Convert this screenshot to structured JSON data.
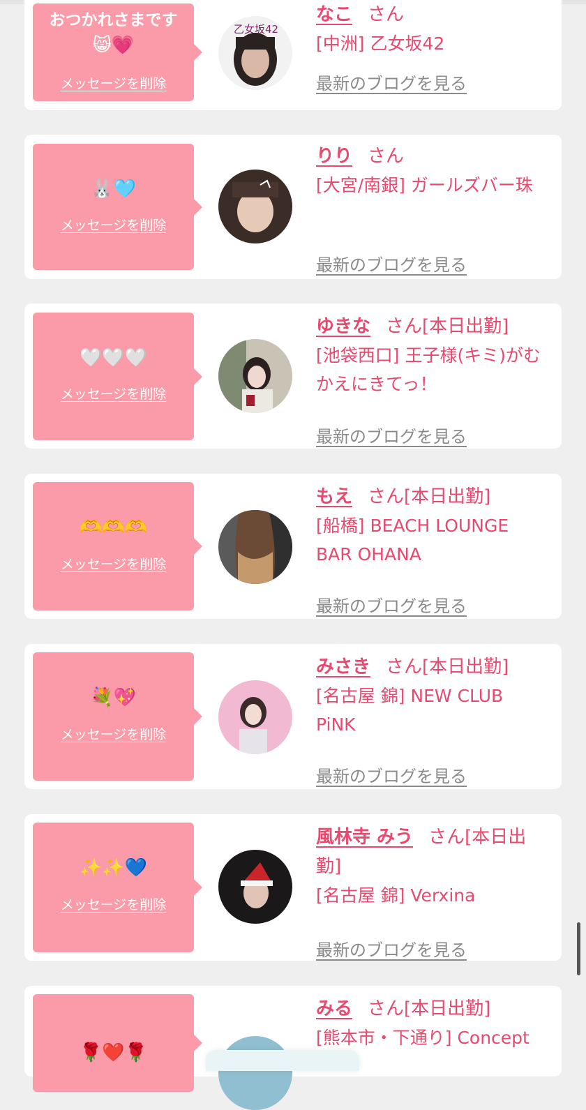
{
  "ui": {
    "delete_label": "メッセージを削除",
    "blog_label": "最新のブログを見る",
    "san_label": "さん"
  },
  "colors": {
    "accent": "#e8496e",
    "bubble": "#fb9aa8",
    "background": "#efefef",
    "card": "#ffffff"
  },
  "messages": [
    {
      "message": "おつかれさまです",
      "emoji": "😸💗",
      "name": "なこ",
      "status": "",
      "shop": "[中洲] 乙女坂42",
      "avatar_text": "乙女坂42"
    },
    {
      "message": "",
      "emoji": "🐰🩵",
      "name": "りり",
      "status": "",
      "shop": "[大宮/南銀] ガールズバー珠"
    },
    {
      "message": "",
      "emoji": "🤍🤍🤍",
      "name": "ゆきな",
      "status": "[本日出勤]",
      "shop": "[池袋西口] 王子様(キミ)がむかえにきてっ！"
    },
    {
      "message": "",
      "emoji": "🫶🫶🫶",
      "name": "もえ",
      "status": "[本日出勤]",
      "shop": "[船橋] BEACH LOUNGE BAR OHANA"
    },
    {
      "message": "",
      "emoji": "💐💖",
      "name": "みさき",
      "status": "[本日出勤]",
      "shop": "[名古屋 錦] NEW CLUB PiNK"
    },
    {
      "message": "",
      "emoji": "✨✨💙",
      "name": "風林寺 みう",
      "status": "[本日出勤]",
      "shop": "[名古屋 錦] Verxina"
    },
    {
      "message": "",
      "emoji": "🌹❤️🌹",
      "name": "みる",
      "status": "[本日出勤]",
      "shop": "[熊本市・下通り] Concept"
    }
  ]
}
